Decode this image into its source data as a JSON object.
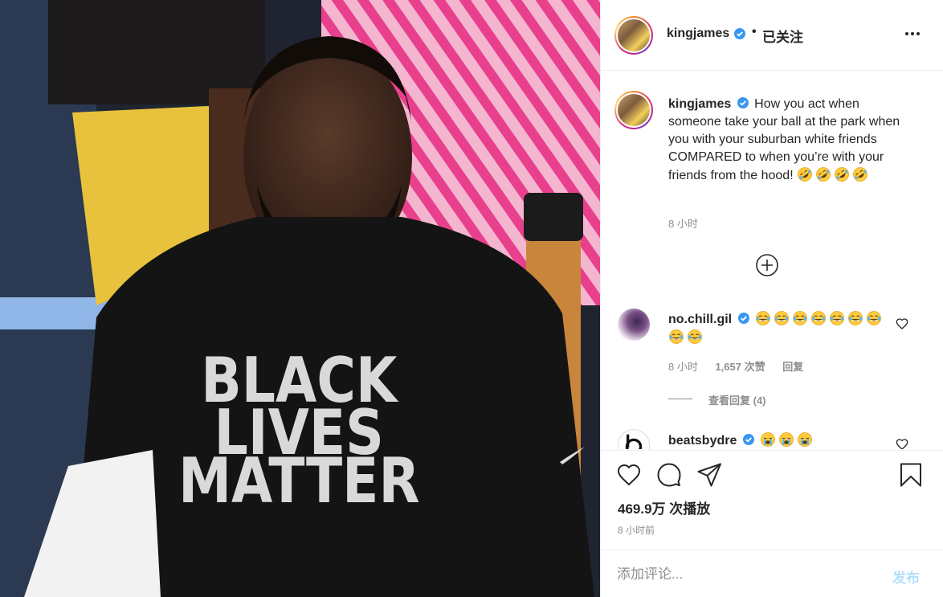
{
  "media": {
    "shirt_line1": "BLACK",
    "shirt_line2": "LIVES",
    "shirt_line3": "MATTER"
  },
  "header": {
    "username": "kingjames",
    "separator": "•",
    "follow_state": "已关注",
    "more_icon": "more-horizontal-icon"
  },
  "caption": {
    "username": "kingjames",
    "text": "How you act when someone take your ball at the park when you with your suburban white friends COMPARED to when you’re with your friends from the hood!",
    "emoji": "rolling-laughing",
    "emoji_count": 4,
    "time": "8 小时"
  },
  "load_more_icon": "plus-circle-icon",
  "comments": [
    {
      "username": "no.chill.gil",
      "emoji": "tears-of-joy",
      "emoji_count": 9,
      "time": "8 小时",
      "likes": "1,657 次赞",
      "reply": "回复",
      "view_replies": "查看回复 (4)"
    },
    {
      "username": "beatsbydre",
      "emoji": "loudly-crying",
      "emoji_count": 3
    }
  ],
  "actions": {
    "views": "469.9万 次播放",
    "posted": "8 小时前"
  },
  "add_comment": {
    "placeholder": "添加评论...",
    "post_label": "发布"
  },
  "colors": {
    "verified": "#3897f0",
    "post_disabled": "#b2dffc",
    "secondary_text": "#8e8e8e"
  }
}
